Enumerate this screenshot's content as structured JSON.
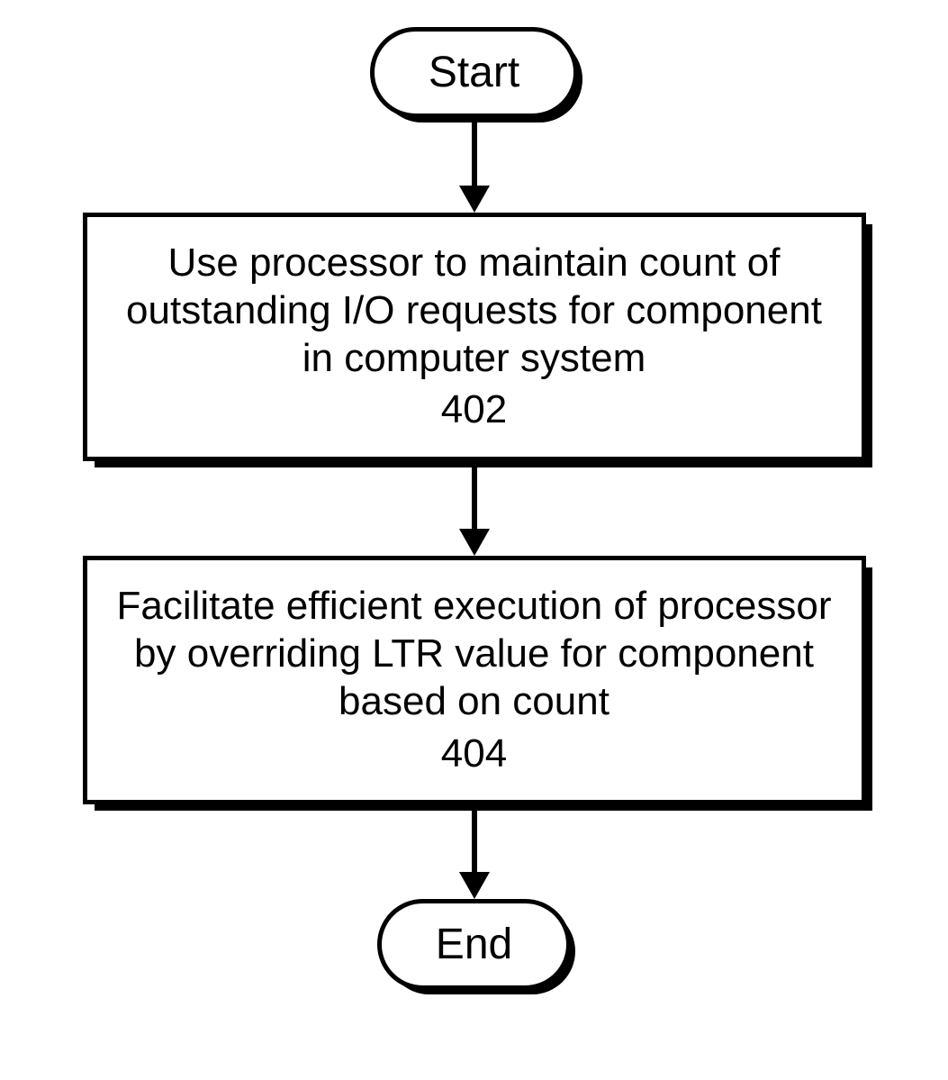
{
  "flowchart": {
    "start": "Start",
    "end": "End",
    "steps": [
      {
        "text": "Use processor to maintain count of outstanding I/O requests for component in computer system",
        "ref": "402"
      },
      {
        "text": "Facilitate efficient execution of processor by overriding LTR value for component based on count",
        "ref": "404"
      }
    ]
  }
}
